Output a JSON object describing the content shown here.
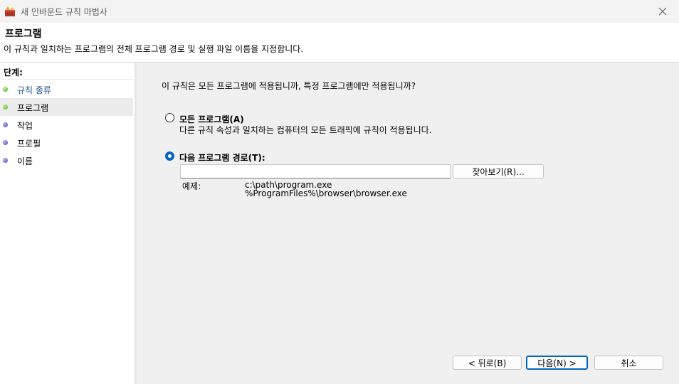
{
  "window": {
    "title": "새 인바운드 규칙 마법사",
    "icon": "firewall-wizard-icon"
  },
  "header": {
    "title": "프로그램",
    "description": "이 규칙과 일치하는 프로그램의 전체 프로그램 경로 및 실행 파일 이름을 지정합니다."
  },
  "sidebar": {
    "heading": "단계:",
    "steps": [
      {
        "label": "규칙 종류",
        "state": "done"
      },
      {
        "label": "프로그램",
        "state": "current"
      },
      {
        "label": "작업",
        "state": "pending"
      },
      {
        "label": "프로필",
        "state": "pending"
      },
      {
        "label": "이름",
        "state": "pending"
      }
    ]
  },
  "main": {
    "question": "이 규칙은 모든 프로그램에 적용됩니까, 특정 프로그램에만 적용됩니까?",
    "option_all": {
      "title": "모든 프로그램(A)",
      "description": "다른 규칙 속성과 일치하는 컴퓨터의 모든 트래픽에 규칙이 적용됩니다.",
      "selected": false
    },
    "option_path": {
      "title": "다음 프로그램 경로(T):",
      "selected": true,
      "value": "",
      "browse_label": "찾아보기(R)...",
      "example_label": "예제:",
      "example_1": "c:\\path\\program.exe",
      "example_2": "%ProgramFiles%\\browser\\browser.exe"
    }
  },
  "footer": {
    "back_label": "< 뒤로(B)",
    "next_label": "다음(N) >",
    "cancel_label": "취소"
  },
  "colors": {
    "accent": "#0067c0",
    "step_done": "#1a4f8a",
    "dot_green": "#4caf2c",
    "dot_purple": "#4b49b5"
  }
}
